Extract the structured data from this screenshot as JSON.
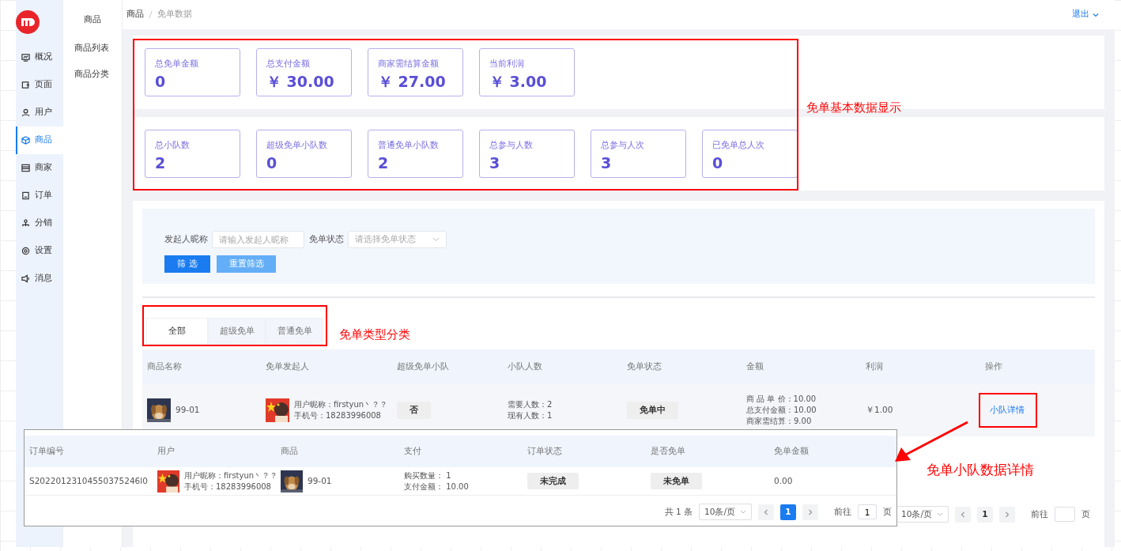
{
  "sidebar": {
    "items": [
      {
        "label": "概况",
        "selected": false
      },
      {
        "label": "页面",
        "selected": false
      },
      {
        "label": "用户",
        "selected": false
      },
      {
        "label": "商品",
        "selected": true
      },
      {
        "label": "商家",
        "selected": false
      },
      {
        "label": "订单",
        "selected": false
      },
      {
        "label": "分销",
        "selected": false
      },
      {
        "label": "设置",
        "selected": false
      },
      {
        "label": "消息",
        "selected": false
      }
    ]
  },
  "submenu": {
    "title": "商品",
    "items": [
      "商品列表",
      "商品分类"
    ]
  },
  "breadcrumb": [
    "商品",
    "免单数据"
  ],
  "logout": "退出",
  "stat_rows": [
    {
      "cards": [
        {
          "label": "总免单金额",
          "value": "0"
        },
        {
          "label": "总支付金额",
          "value": "￥ 30.00"
        },
        {
          "label": "商家需结算金额",
          "value": "￥ 27.00"
        },
        {
          "label": "当前利润",
          "value": "￥ 3.00"
        }
      ]
    },
    {
      "cards": [
        {
          "label": "总小队数",
          "value": "2"
        },
        {
          "label": "超级免单小队数",
          "value": "0"
        },
        {
          "label": "普通免单小队数",
          "value": "2"
        },
        {
          "label": "总参与人数",
          "value": "3"
        },
        {
          "label": "总参与人次",
          "value": "3"
        },
        {
          "label": "已免单总人次",
          "value": "0"
        }
      ]
    }
  ],
  "filter": {
    "fields": [
      {
        "kind": "input",
        "label": "发起人昵称",
        "placeholder": "请输入发起人昵称"
      },
      {
        "kind": "select",
        "label": "免单状态",
        "placeholder": "请选择免单状态"
      }
    ],
    "buttons": [
      {
        "kind": "primary",
        "label": "筛 选"
      },
      {
        "kind": "light",
        "label": "重置筛选"
      }
    ]
  },
  "tabs": [
    {
      "label": "全部",
      "selected": true
    },
    {
      "label": "超级免单",
      "selected": false
    },
    {
      "label": "普通免单",
      "selected": false
    }
  ],
  "table": {
    "columns": [
      "商品名称",
      "免单发起人",
      "超级免单小队",
      "小队人数",
      "免单状态",
      "金额",
      "利润",
      "操作"
    ],
    "rows": [
      {
        "product": "99-01",
        "initiator": [
          "用户昵称：firstyun丶？？",
          "手机号：18283996008"
        ],
        "super_team": "否",
        "members": [
          "需要人数：2",
          "现有人数：1"
        ],
        "status": "免单中",
        "amount": [
          "商 品 单 价：10.00",
          "总支付金额：10.00",
          "商家需结算：9.00"
        ],
        "profit": "￥1.00",
        "action": "小队详情"
      }
    ]
  },
  "pagination": {
    "page_size": "10条/页",
    "pages": [
      {
        "label": "1",
        "selected": false
      }
    ],
    "goto_label": "前往",
    "goto_unit": "页"
  },
  "popup": {
    "columns": [
      "订单编号",
      "用户",
      "商品",
      "支付",
      "订单状态",
      "是否免单",
      "免单金额"
    ],
    "rows": [
      {
        "order_no": "S20220123104550375246l0",
        "user": [
          "用户昵称：firstyun丶？？",
          "手机号：18283996008"
        ],
        "product": "99-01",
        "payment": [
          "购买数量：  1",
          "支付金额：  10.00"
        ],
        "order_status": "未完成",
        "is_free": "未免单",
        "free_amount": "0.00"
      }
    ],
    "pagination": {
      "total": "共 1 条",
      "page_size": "10条/页",
      "pages": [
        {
          "label": "1",
          "selected": true
        }
      ],
      "goto_label": "前往",
      "goto_value": "1",
      "goto_unit": "页"
    }
  },
  "annotations": [
    "免单基本数据显示",
    "免单类型分类",
    "免单小队数据详情"
  ]
}
